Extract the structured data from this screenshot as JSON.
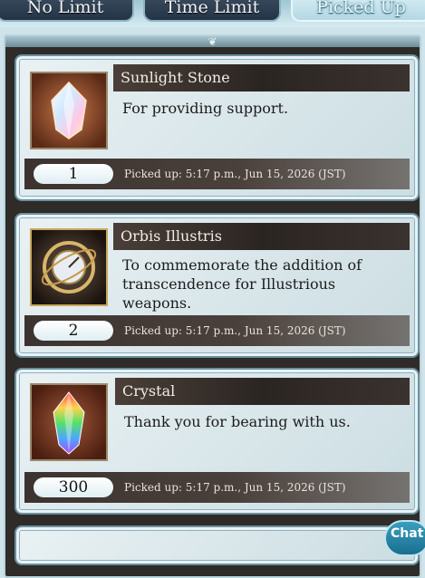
{
  "tabs": [
    {
      "label": "No Limit"
    },
    {
      "label": "Time Limit"
    },
    {
      "label": "Picked Up"
    }
  ],
  "items": [
    {
      "name": "Sunlight Stone",
      "message": "For providing support.",
      "quantity": "1",
      "picked_up": "Picked up: 5:17 p.m., Jun 15, 2026 (JST)",
      "icon": "sunlight-stone-icon"
    },
    {
      "name": "Orbis Illustris",
      "message": "To commemorate the addition of transcendence for Illustrious weapons.",
      "quantity": "2",
      "picked_up": "Picked up: 5:17 p.m., Jun 15, 2026 (JST)",
      "icon": "orbis-illustris-icon"
    },
    {
      "name": "Crystal",
      "message": "Thank you for bearing with us.",
      "quantity": "300",
      "picked_up": "Picked up: 5:17 p.m., Jun 15, 2026 (JST)",
      "icon": "crystal-icon"
    }
  ],
  "chat_label": "Chat"
}
